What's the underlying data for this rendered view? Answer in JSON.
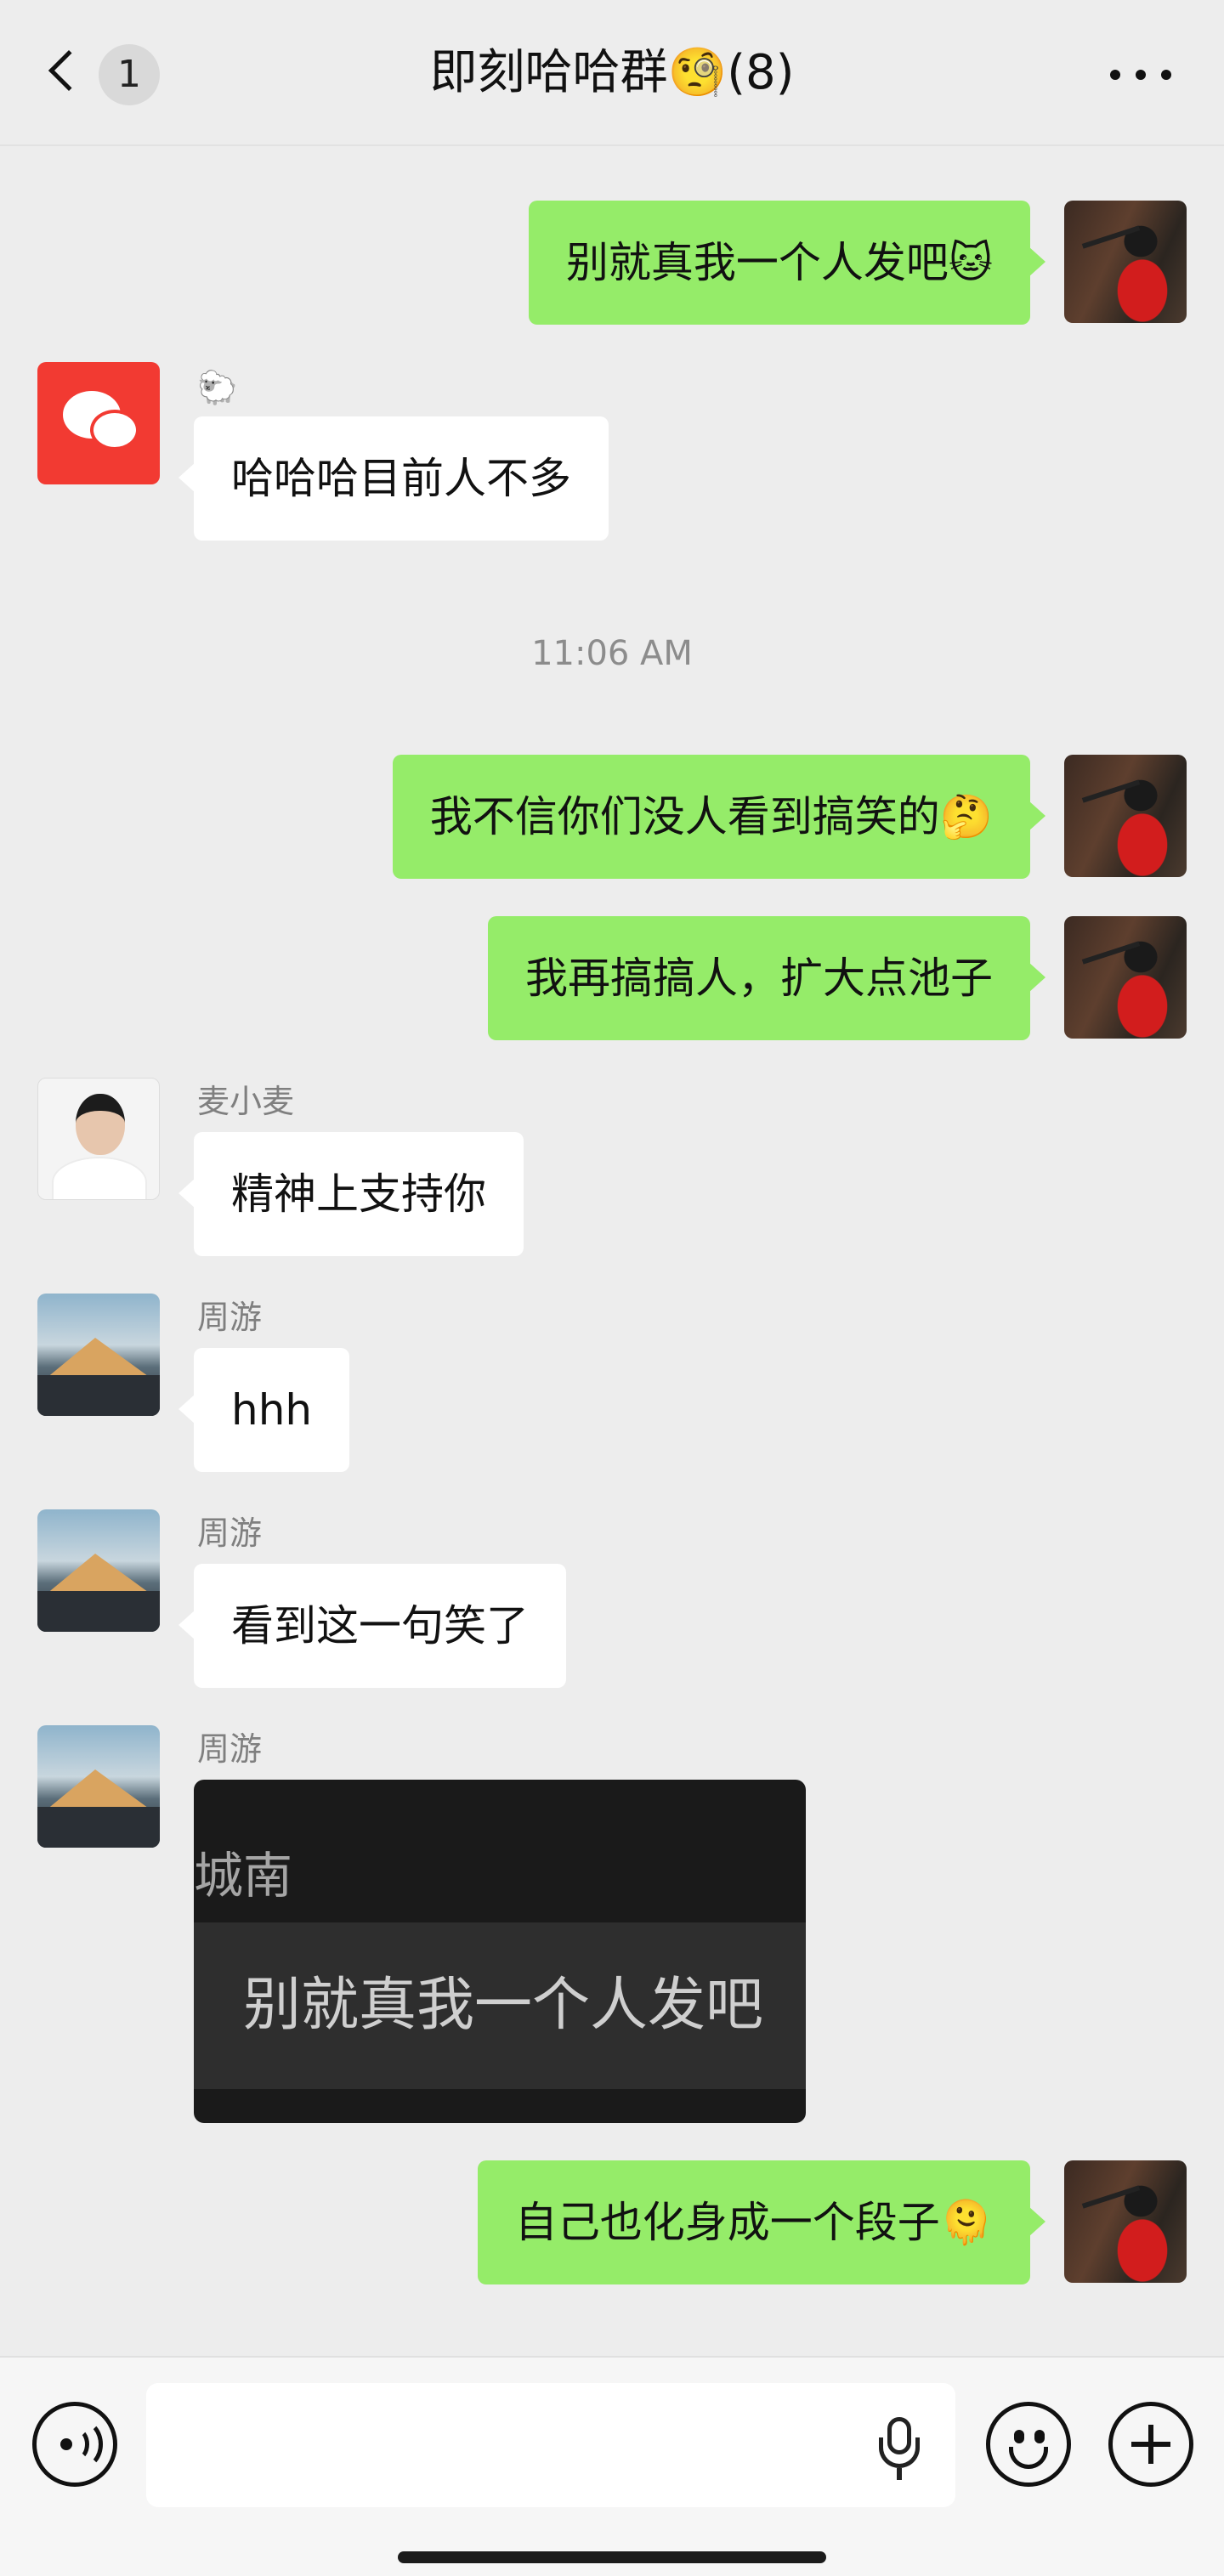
{
  "header": {
    "unread_count": "1",
    "title": "即刻哈哈群🧐(8)"
  },
  "messages": [
    {
      "direction": "out",
      "text": "别就真我一个人发吧🐱"
    },
    {
      "direction": "in",
      "sender": "🐑",
      "text": "哈哈哈目前人不多"
    },
    {
      "direction": "out",
      "text": "我不信你们没人看到搞笑的🤔"
    },
    {
      "direction": "out",
      "text": "我再搞搞人，扩大点池子"
    },
    {
      "direction": "in",
      "sender": "麦小麦",
      "text": "精神上支持你"
    },
    {
      "direction": "in",
      "sender": "周游",
      "text": "hhh"
    },
    {
      "direction": "in",
      "sender": "周游",
      "text": "看到这一句笑了"
    },
    {
      "direction": "in",
      "sender": "周游",
      "image": {
        "quoted_sender": "城南",
        "quoted_text": "别就真我一个人发吧"
      }
    },
    {
      "direction": "out",
      "text": "自己也化身成一个段子🫠"
    }
  ],
  "timestamp": "11:06 AM",
  "input_bar": {
    "message_value": ""
  }
}
